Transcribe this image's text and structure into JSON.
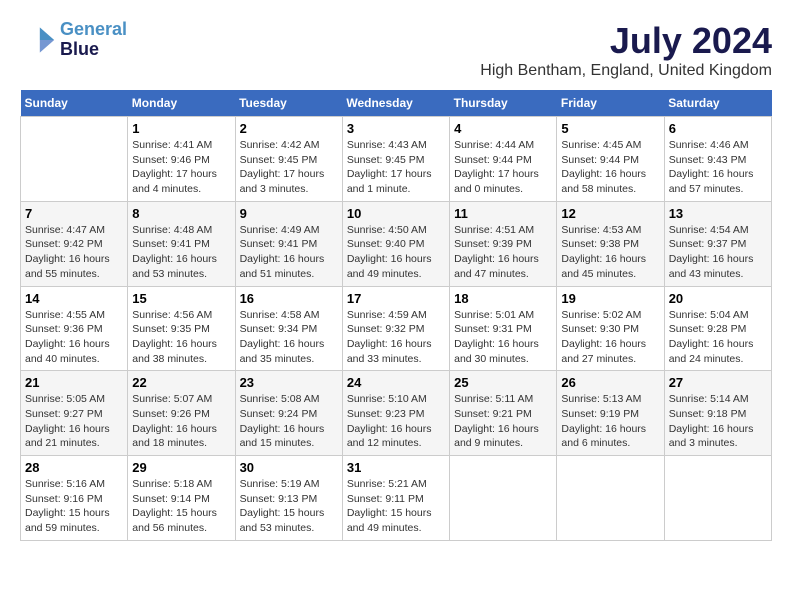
{
  "header": {
    "logo_line1": "General",
    "logo_line2": "Blue",
    "month_year": "July 2024",
    "location": "High Bentham, England, United Kingdom"
  },
  "weekdays": [
    "Sunday",
    "Monday",
    "Tuesday",
    "Wednesday",
    "Thursday",
    "Friday",
    "Saturday"
  ],
  "weeks": [
    [
      {
        "day": "",
        "info": ""
      },
      {
        "day": "1",
        "info": "Sunrise: 4:41 AM\nSunset: 9:46 PM\nDaylight: 17 hours\nand 4 minutes."
      },
      {
        "day": "2",
        "info": "Sunrise: 4:42 AM\nSunset: 9:45 PM\nDaylight: 17 hours\nand 3 minutes."
      },
      {
        "day": "3",
        "info": "Sunrise: 4:43 AM\nSunset: 9:45 PM\nDaylight: 17 hours\nand 1 minute."
      },
      {
        "day": "4",
        "info": "Sunrise: 4:44 AM\nSunset: 9:44 PM\nDaylight: 17 hours\nand 0 minutes."
      },
      {
        "day": "5",
        "info": "Sunrise: 4:45 AM\nSunset: 9:44 PM\nDaylight: 16 hours\nand 58 minutes."
      },
      {
        "day": "6",
        "info": "Sunrise: 4:46 AM\nSunset: 9:43 PM\nDaylight: 16 hours\nand 57 minutes."
      }
    ],
    [
      {
        "day": "7",
        "info": "Sunrise: 4:47 AM\nSunset: 9:42 PM\nDaylight: 16 hours\nand 55 minutes."
      },
      {
        "day": "8",
        "info": "Sunrise: 4:48 AM\nSunset: 9:41 PM\nDaylight: 16 hours\nand 53 minutes."
      },
      {
        "day": "9",
        "info": "Sunrise: 4:49 AM\nSunset: 9:41 PM\nDaylight: 16 hours\nand 51 minutes."
      },
      {
        "day": "10",
        "info": "Sunrise: 4:50 AM\nSunset: 9:40 PM\nDaylight: 16 hours\nand 49 minutes."
      },
      {
        "day": "11",
        "info": "Sunrise: 4:51 AM\nSunset: 9:39 PM\nDaylight: 16 hours\nand 47 minutes."
      },
      {
        "day": "12",
        "info": "Sunrise: 4:53 AM\nSunset: 9:38 PM\nDaylight: 16 hours\nand 45 minutes."
      },
      {
        "day": "13",
        "info": "Sunrise: 4:54 AM\nSunset: 9:37 PM\nDaylight: 16 hours\nand 43 minutes."
      }
    ],
    [
      {
        "day": "14",
        "info": "Sunrise: 4:55 AM\nSunset: 9:36 PM\nDaylight: 16 hours\nand 40 minutes."
      },
      {
        "day": "15",
        "info": "Sunrise: 4:56 AM\nSunset: 9:35 PM\nDaylight: 16 hours\nand 38 minutes."
      },
      {
        "day": "16",
        "info": "Sunrise: 4:58 AM\nSunset: 9:34 PM\nDaylight: 16 hours\nand 35 minutes."
      },
      {
        "day": "17",
        "info": "Sunrise: 4:59 AM\nSunset: 9:32 PM\nDaylight: 16 hours\nand 33 minutes."
      },
      {
        "day": "18",
        "info": "Sunrise: 5:01 AM\nSunset: 9:31 PM\nDaylight: 16 hours\nand 30 minutes."
      },
      {
        "day": "19",
        "info": "Sunrise: 5:02 AM\nSunset: 9:30 PM\nDaylight: 16 hours\nand 27 minutes."
      },
      {
        "day": "20",
        "info": "Sunrise: 5:04 AM\nSunset: 9:28 PM\nDaylight: 16 hours\nand 24 minutes."
      }
    ],
    [
      {
        "day": "21",
        "info": "Sunrise: 5:05 AM\nSunset: 9:27 PM\nDaylight: 16 hours\nand 21 minutes."
      },
      {
        "day": "22",
        "info": "Sunrise: 5:07 AM\nSunset: 9:26 PM\nDaylight: 16 hours\nand 18 minutes."
      },
      {
        "day": "23",
        "info": "Sunrise: 5:08 AM\nSunset: 9:24 PM\nDaylight: 16 hours\nand 15 minutes."
      },
      {
        "day": "24",
        "info": "Sunrise: 5:10 AM\nSunset: 9:23 PM\nDaylight: 16 hours\nand 12 minutes."
      },
      {
        "day": "25",
        "info": "Sunrise: 5:11 AM\nSunset: 9:21 PM\nDaylight: 16 hours\nand 9 minutes."
      },
      {
        "day": "26",
        "info": "Sunrise: 5:13 AM\nSunset: 9:19 PM\nDaylight: 16 hours\nand 6 minutes."
      },
      {
        "day": "27",
        "info": "Sunrise: 5:14 AM\nSunset: 9:18 PM\nDaylight: 16 hours\nand 3 minutes."
      }
    ],
    [
      {
        "day": "28",
        "info": "Sunrise: 5:16 AM\nSunset: 9:16 PM\nDaylight: 15 hours\nand 59 minutes."
      },
      {
        "day": "29",
        "info": "Sunrise: 5:18 AM\nSunset: 9:14 PM\nDaylight: 15 hours\nand 56 minutes."
      },
      {
        "day": "30",
        "info": "Sunrise: 5:19 AM\nSunset: 9:13 PM\nDaylight: 15 hours\nand 53 minutes."
      },
      {
        "day": "31",
        "info": "Sunrise: 5:21 AM\nSunset: 9:11 PM\nDaylight: 15 hours\nand 49 minutes."
      },
      {
        "day": "",
        "info": ""
      },
      {
        "day": "",
        "info": ""
      },
      {
        "day": "",
        "info": ""
      }
    ]
  ]
}
